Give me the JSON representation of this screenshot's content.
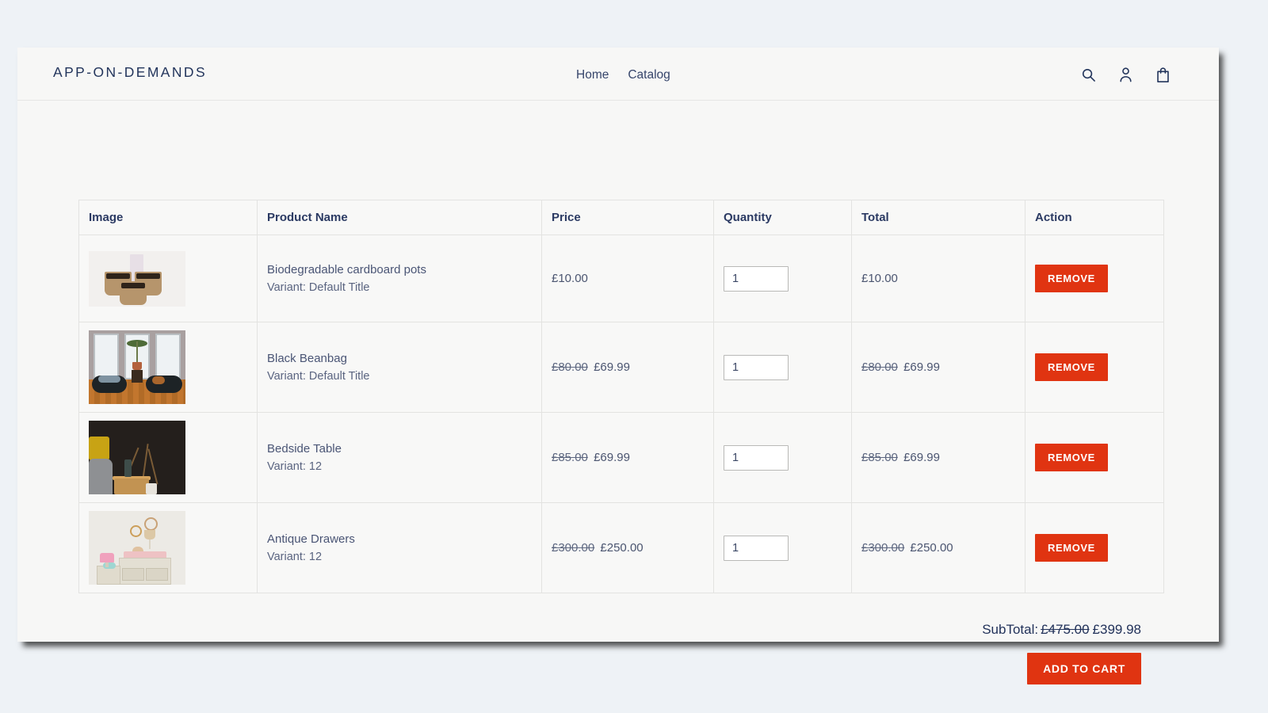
{
  "header": {
    "logo": "APP-ON-DEMANDS",
    "nav": [
      {
        "label": "Home"
      },
      {
        "label": "Catalog"
      }
    ],
    "icons": [
      {
        "name": "search-icon",
        "label": "Search"
      },
      {
        "name": "account-icon",
        "label": "Account"
      },
      {
        "name": "cart-icon",
        "label": "Cart"
      }
    ]
  },
  "table": {
    "columns": [
      "Image",
      "Product Name",
      "Price",
      "Quantity",
      "Total",
      "Action"
    ],
    "rows": [
      {
        "image_alt": "Biodegradable cardboard pots with soil",
        "name": "Biodegradable cardboard pots",
        "variant": "Variant: Default Title",
        "price_old": "",
        "price_new": "£10.00",
        "quantity": "1",
        "total_old": "",
        "total_new": "£10.00",
        "action_label": "REMOVE"
      },
      {
        "image_alt": "Black beanbags in front of windows",
        "name": "Black Beanbag",
        "variant": "Variant: Default Title",
        "price_old": "£80.00",
        "price_new": "£69.99",
        "quantity": "1",
        "total_old": "£80.00",
        "total_new": "£69.99",
        "action_label": "REMOVE"
      },
      {
        "image_alt": "Bedside table with dried branches against dark wall",
        "name": "Bedside Table",
        "variant": "Variant: 12",
        "price_old": "£85.00",
        "price_new": "£69.99",
        "quantity": "1",
        "total_old": "£85.00",
        "total_new": "£69.99",
        "action_label": "REMOVE"
      },
      {
        "image_alt": "Antique drawers in a nursery",
        "name": "Antique Drawers",
        "variant": "Variant: 12",
        "price_old": "£300.00",
        "price_new": "£250.00",
        "quantity": "1",
        "total_old": "£300.00",
        "total_new": "£250.00",
        "action_label": "REMOVE"
      }
    ]
  },
  "summary": {
    "subtotal_label": "SubTotal:",
    "subtotal_old": "£475.00",
    "subtotal_new": "£399.98",
    "add_to_cart_label": "ADD TO CART"
  },
  "quantity_placeholder": "1",
  "colors": {
    "accent_red": "#e03411",
    "text_navy": "#23355c",
    "page_background": "#eef2f6",
    "panel_background": "#f7f7f6"
  }
}
